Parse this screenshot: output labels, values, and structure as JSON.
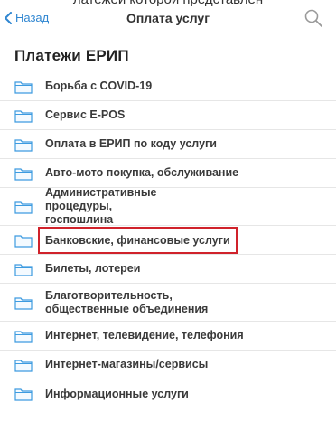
{
  "top_text": "латежей которой представлен",
  "navbar": {
    "back_label": "Назад",
    "title": "Оплата услуг"
  },
  "section_title": "Платежи ЕРИП",
  "items": [
    {
      "label": "Борьба с COVID-19"
    },
    {
      "label": "Сервис E-POS"
    },
    {
      "label": "Оплата в ЕРИП по коду услуги"
    },
    {
      "label": "Авто-мото покупка, обслуживание"
    },
    {
      "label": "Административные процедуры, госпошлина"
    },
    {
      "label": "Банковские, финансовые услуги",
      "highlighted": true
    },
    {
      "label": "Билеты, лотереи"
    },
    {
      "label": "Благотворительность, общественные объединения"
    },
    {
      "label": "Интернет, телевидение, телефония"
    },
    {
      "label": "Интернет-магазины/сервисы"
    },
    {
      "label": "Информационные услуги"
    }
  ],
  "colors": {
    "accent": "#2f86d1",
    "highlight_border": "#d0222b",
    "folder_stroke": "#3d9be0"
  }
}
